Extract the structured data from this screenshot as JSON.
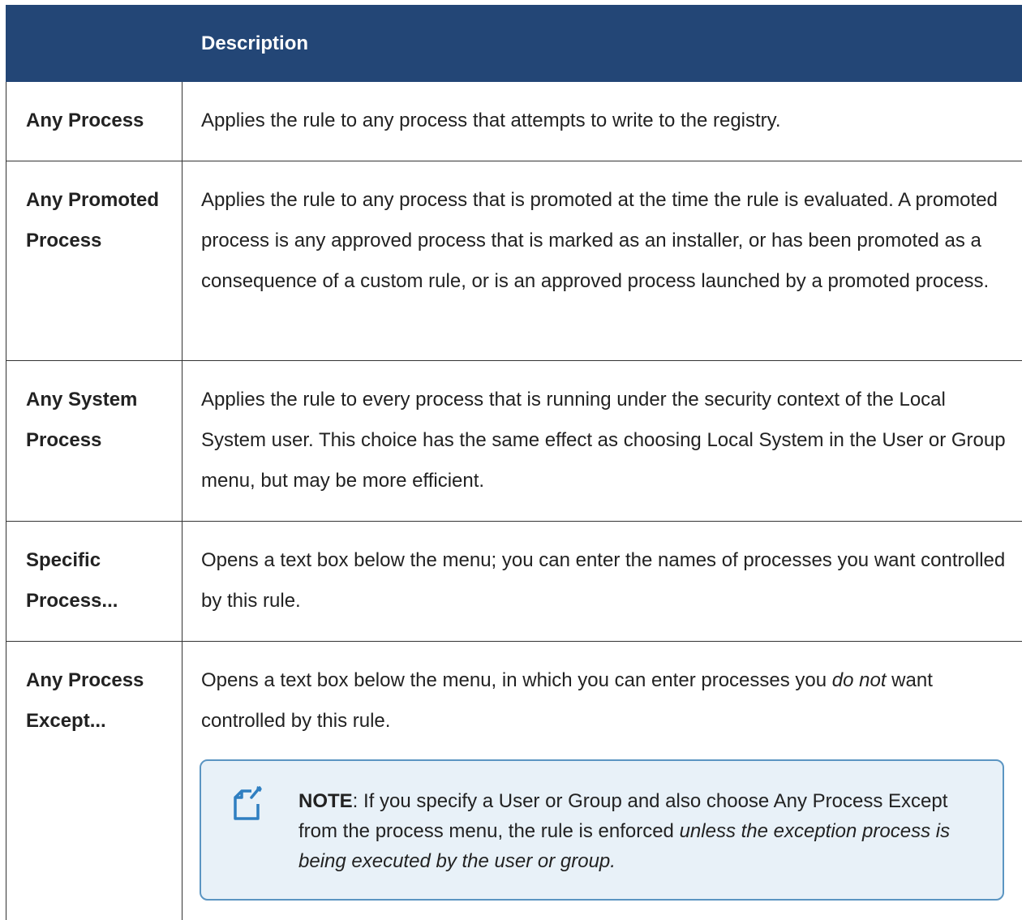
{
  "table": {
    "header": {
      "col1": "",
      "col2": "Description"
    },
    "rows": [
      {
        "name": "Any Process",
        "description": "Applies the rule to any process that attempts to write to the registry."
      },
      {
        "name": "Any Promoted Process",
        "description": "Applies the rule to any process that is promoted at the time the rule is evaluated. A promoted process is any approved process that is marked as an installer, or has been promoted as a consequence of a custom rule, or is an approved process launched by a promoted process."
      },
      {
        "name": "Any System Process",
        "description": "Applies the rule to every process that is running under the security context of the Local System user. This choice has the same effect as choosing Local System in the User or Group menu, but may be more efficient."
      },
      {
        "name": "Specific Process...",
        "description": "Opens a text box below the menu; you can enter the names of processes you want controlled by this rule."
      },
      {
        "name": "Any Process Except...",
        "description_part1": "Opens a text box below the menu, in which you can enter processes you ",
        "description_emphasis": "do not",
        "description_part2": " want controlled by this rule."
      }
    ]
  },
  "note": {
    "icon": "note-edit-icon",
    "label": "NOTE",
    "text_plain": ": If you specify a User or Group and also choose Any Process Except from the process menu, the rule is enforced ",
    "text_emphasis": "unless the exception process is being executed by the user or group."
  },
  "colors": {
    "header_bg": "#234676",
    "note_bg": "#e8f1f8",
    "note_border": "#5b95c2",
    "icon_blue": "#2f7fc1"
  }
}
